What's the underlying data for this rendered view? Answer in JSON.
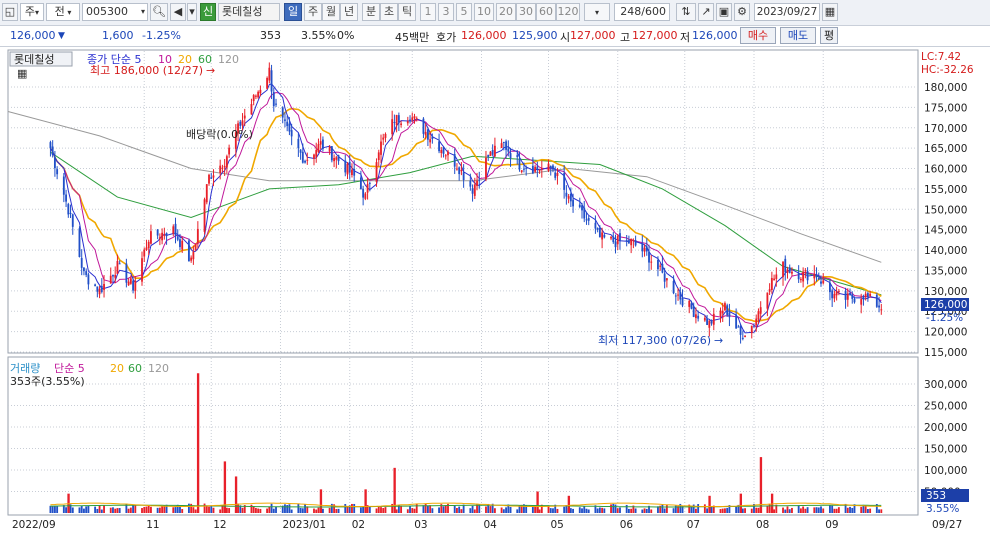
{
  "toolbar": {
    "type_label": "주",
    "prev_label": "전",
    "code": "005300",
    "name_badge": "신",
    "stock_name": "롯데칠성",
    "periods": [
      "일",
      "주",
      "월",
      "년",
      "분",
      "초",
      "틱"
    ],
    "period_active": "일",
    "numbers": [
      "1",
      "3",
      "5",
      "10",
      "20",
      "30",
      "60",
      "120"
    ],
    "count": "248",
    "count_total": "/600",
    "date": "2023/09/27"
  },
  "info": {
    "price": "126,000",
    "change_arrow": "▼",
    "change": "1,600",
    "change_pct": "-1.25%",
    "volume": "353",
    "turnover_pct": "3.55%",
    "ratio": "0%",
    "value": "45백만",
    "quote_label": "호가",
    "ask": "126,000",
    "bid": "125,900",
    "open_label": "시",
    "open": "127,000",
    "high_label": "고",
    "high": "127,000",
    "low_label": "저",
    "low": "126,000",
    "buy_btn": "매수",
    "sell_btn": "매도",
    "eval_btn": "평"
  },
  "colors": {
    "up": "#e8202a",
    "down": "#2150c8",
    "ma5": "#2a2fd0",
    "ma10": "#c0189a",
    "ma20": "#f0a800",
    "ma60": "#2f9e3e",
    "ma120": "#999999",
    "grid": "#c8cdd6"
  },
  "chart_data": [
    {
      "type": "candlestick",
      "title_label": "롯데칠성",
      "legend": [
        {
          "name": "종가 단순 5",
          "color": "#2a2fd0"
        },
        {
          "name": "10",
          "color": "#c0189a"
        },
        {
          "name": "20",
          "color": "#f0a800"
        },
        {
          "name": "60",
          "color": "#2f9e3e"
        },
        {
          "name": "120",
          "color": "#999999"
        }
      ],
      "annotations": {
        "high_label": "최고 186,000 (12/27)",
        "low_label": "최저 117,300 (07/26)",
        "dividend_label": "배당락(0.0%)",
        "lc_label": "LC:7.42",
        "hc_label": "HC:-32.26",
        "last_price_label": "126,000",
        "last_change_label": "-1.25%"
      },
      "ylim": [
        115000,
        185000
      ],
      "yticks": [
        "180,000",
        "175,000",
        "170,000",
        "165,000",
        "160,000",
        "155,000",
        "150,000",
        "145,000",
        "140,000",
        "135,000",
        "130,000",
        "125,000",
        "120,000",
        "115,000"
      ],
      "x_labels": [
        "2022/09",
        "11",
        "12",
        "2023/01",
        "02",
        "03",
        "04",
        "05",
        "06",
        "07",
        "08",
        "09"
      ],
      "x_end_label": "09/27",
      "close_series": [
        {
          "d": "2022/09/20",
          "v": 165000
        },
        {
          "d": "2022/09/28",
          "v": 150000
        },
        {
          "d": "2022/10/05",
          "v": 134000
        },
        {
          "d": "2022/10/12",
          "v": 130000
        },
        {
          "d": "2022/10/20",
          "v": 136000
        },
        {
          "d": "2022/10/27",
          "v": 131000
        },
        {
          "d": "2022/11/03",
          "v": 143000
        },
        {
          "d": "2022/11/14",
          "v": 145000
        },
        {
          "d": "2022/11/22",
          "v": 137000
        },
        {
          "d": "2022/11/30",
          "v": 158000
        },
        {
          "d": "2022/12/07",
          "v": 162000
        },
        {
          "d": "2022/12/14",
          "v": 171000
        },
        {
          "d": "2022/12/21",
          "v": 178000
        },
        {
          "d": "2022/12/27",
          "v": 184000
        },
        {
          "d": "2022/12/29",
          "v": 176000
        },
        {
          "d": "2023/01/05",
          "v": 168000
        },
        {
          "d": "2023/01/12",
          "v": 162000
        },
        {
          "d": "2023/01/19",
          "v": 166000
        },
        {
          "d": "2023/01/27",
          "v": 162000
        },
        {
          "d": "2023/02/03",
          "v": 158000
        },
        {
          "d": "2023/02/08",
          "v": 153000
        },
        {
          "d": "2023/02/14",
          "v": 165000
        },
        {
          "d": "2023/02/21",
          "v": 172000
        },
        {
          "d": "2023/02/28",
          "v": 173000
        },
        {
          "d": "2023/03/07",
          "v": 169000
        },
        {
          "d": "2023/03/14",
          "v": 165000
        },
        {
          "d": "2023/03/21",
          "v": 161000
        },
        {
          "d": "2023/03/28",
          "v": 155000
        },
        {
          "d": "2023/04/04",
          "v": 163000
        },
        {
          "d": "2023/04/11",
          "v": 166000
        },
        {
          "d": "2023/04/18",
          "v": 161000
        },
        {
          "d": "2023/04/26",
          "v": 160000
        },
        {
          "d": "2023/05/03",
          "v": 160000
        },
        {
          "d": "2023/05/10",
          "v": 152000
        },
        {
          "d": "2023/05/17",
          "v": 148000
        },
        {
          "d": "2023/05/24",
          "v": 143000
        },
        {
          "d": "2023/05/31",
          "v": 142000
        },
        {
          "d": "2023/06/07",
          "v": 142000
        },
        {
          "d": "2023/06/14",
          "v": 139000
        },
        {
          "d": "2023/06/21",
          "v": 134000
        },
        {
          "d": "2023/06/28",
          "v": 129000
        },
        {
          "d": "2023/07/05",
          "v": 125000
        },
        {
          "d": "2023/07/12",
          "v": 122000
        },
        {
          "d": "2023/07/19",
          "v": 126000
        },
        {
          "d": "2023/07/26",
          "v": 119000
        },
        {
          "d": "2023/08/01",
          "v": 122000
        },
        {
          "d": "2023/08/07",
          "v": 131000
        },
        {
          "d": "2023/08/14",
          "v": 136000
        },
        {
          "d": "2023/08/22",
          "v": 134000
        },
        {
          "d": "2023/08/29",
          "v": 134000
        },
        {
          "d": "2023/09/05",
          "v": 129000
        },
        {
          "d": "2023/09/12",
          "v": 128000
        },
        {
          "d": "2023/09/19",
          "v": 129000
        },
        {
          "d": "2023/09/27",
          "v": 126000
        }
      ],
      "ma60": [
        {
          "d": "2022/09/20",
          "v": 164000
        },
        {
          "d": "2022/10/20",
          "v": 153000
        },
        {
          "d": "2022/11/22",
          "v": 148000
        },
        {
          "d": "2022/12/27",
          "v": 155000
        },
        {
          "d": "2023/01/27",
          "v": 156000
        },
        {
          "d": "2023/02/28",
          "v": 159000
        },
        {
          "d": "2023/03/28",
          "v": 163000
        },
        {
          "d": "2023/04/26",
          "v": 162000
        },
        {
          "d": "2023/05/24",
          "v": 161000
        },
        {
          "d": "2023/06/21",
          "v": 155000
        },
        {
          "d": "2023/07/19",
          "v": 146000
        },
        {
          "d": "2023/08/14",
          "v": 136000
        },
        {
          "d": "2023/09/27",
          "v": 129000
        }
      ],
      "ma120": [
        {
          "d": "2022/09/01",
          "v": 174000
        },
        {
          "d": "2022/10/12",
          "v": 168000
        },
        {
          "d": "2022/11/22",
          "v": 160000
        },
        {
          "d": "2022/12/27",
          "v": 157000
        },
        {
          "d": "2023/02/08",
          "v": 157000
        },
        {
          "d": "2023/03/28",
          "v": 157000
        },
        {
          "d": "2023/05/10",
          "v": 160000
        },
        {
          "d": "2023/06/14",
          "v": 158000
        },
        {
          "d": "2023/07/19",
          "v": 151000
        },
        {
          "d": "2023/08/22",
          "v": 144000
        },
        {
          "d": "2023/09/27",
          "v": 137000
        }
      ]
    },
    {
      "type": "bar",
      "legend": [
        {
          "name": "거래량",
          "color": "#2a8fc8"
        },
        {
          "name": "단순 5",
          "color": "#c0189a"
        },
        {
          "name": "20",
          "color": "#f0a800"
        },
        {
          "name": "60",
          "color": "#2f9e3e"
        },
        {
          "name": "120",
          "color": "#999999"
        }
      ],
      "sub_label": "353주(3.55%)",
      "ylim": [
        0,
        330000
      ],
      "yticks": [
        "300,000",
        "250,000",
        "200,000",
        "150,000",
        "100,000",
        "50,000"
      ],
      "last_volume_label": "353",
      "last_pct_label": "3.55%",
      "spikes": [
        {
          "d": "2022/09/28",
          "v": 45000
        },
        {
          "d": "2022/11/25",
          "v": 325000
        },
        {
          "d": "2022/12/07",
          "v": 120000
        },
        {
          "d": "2022/12/12",
          "v": 85000
        },
        {
          "d": "2023/01/19",
          "v": 55000
        },
        {
          "d": "2023/02/08",
          "v": 55000
        },
        {
          "d": "2023/02/21",
          "v": 105000
        },
        {
          "d": "2023/04/26",
          "v": 50000
        },
        {
          "d": "2023/05/10",
          "v": 40000
        },
        {
          "d": "2023/07/12",
          "v": 40000
        },
        {
          "d": "2023/07/26",
          "v": 45000
        },
        {
          "d": "2023/08/04",
          "v": 130000
        },
        {
          "d": "2023/08/09",
          "v": 45000
        }
      ]
    }
  ]
}
